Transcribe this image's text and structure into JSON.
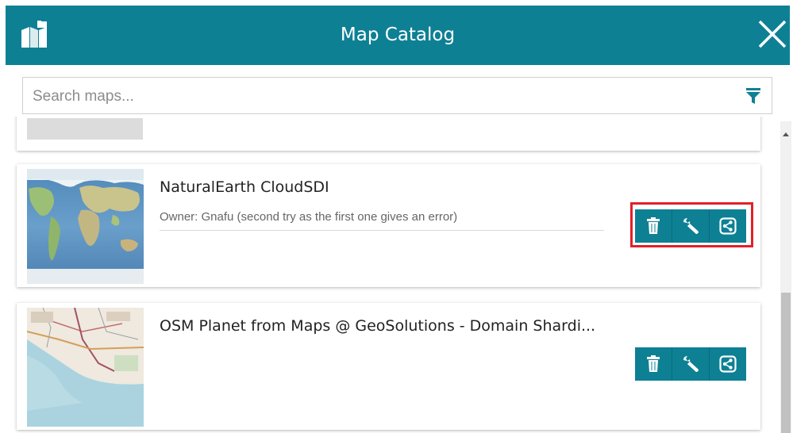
{
  "header": {
    "title": "Map Catalog",
    "logo_icon": "map-catalog-icon",
    "close_icon": "close-icon",
    "background": "#0e8094"
  },
  "search": {
    "placeholder": "Search maps...",
    "value": "",
    "filter_icon": "filter-icon"
  },
  "maps": [
    {
      "name": "NaturalEarth CloudSDI",
      "description": "Owner: Gnafu (second try as the first one gives an error)",
      "actions": [
        "delete",
        "edit",
        "share"
      ],
      "highlighted": true
    },
    {
      "name": "OSM Planet from Maps @ GeoSolutions - Domain Shardi...",
      "description": "",
      "actions": [
        "delete",
        "edit",
        "share"
      ],
      "highlighted": false
    }
  ],
  "colors": {
    "accent": "#0e8094",
    "highlight": "#e2202a"
  }
}
